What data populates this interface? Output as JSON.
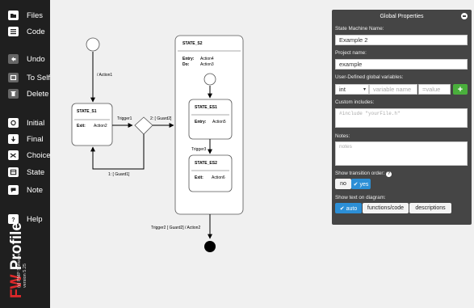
{
  "sidebar": {
    "items": [
      {
        "label": "Files",
        "icon": "folder-icon"
      },
      {
        "label": "Code",
        "icon": "list-icon"
      },
      {
        "label": "Undo",
        "icon": "undo-icon"
      },
      {
        "label": "To Self",
        "icon": "self-loop-icon"
      },
      {
        "label": "Delete",
        "icon": "trash-icon"
      },
      {
        "label": "Initial",
        "icon": "initial-state-icon"
      },
      {
        "label": "Final",
        "icon": "final-state-icon"
      },
      {
        "label": "Choice",
        "icon": "shuffle-icon"
      },
      {
        "label": "State",
        "icon": "state-icon"
      },
      {
        "label": "Note",
        "icon": "note-icon"
      },
      {
        "label": "Help",
        "icon": "help-icon"
      }
    ],
    "brand": {
      "fw": "FW",
      "profile": "Profile",
      "company": "(c) PMP Software",
      "version": "version 5.25"
    }
  },
  "diagram": {
    "s1": {
      "title": "STATE_S1",
      "exit_label": "Exit:",
      "exit_value": "Action2"
    },
    "s2": {
      "title": "STATE_S2",
      "entry_label": "Entry:",
      "entry_value": "Action4",
      "do_label": "Do:",
      "do_value": "Action3"
    },
    "es1": {
      "title": "STATE_ES1",
      "entry_label": "Entry:",
      "entry_value": "Action5"
    },
    "es2": {
      "title": "STATE_ES2",
      "exit_label": "Exit:",
      "exit_value": "Action6"
    },
    "labels": {
      "action1": "/ Action1",
      "trigger1": "Trigger1",
      "guard2": "2: [ Guard2]",
      "guard1": "1: [ Guard1]",
      "trigger3": "Trigger3",
      "trigger2": "Trigger2 [ Guard2] / Action2"
    }
  },
  "props": {
    "title": "Global Properties",
    "sm_name_label": "State Machine Name:",
    "sm_name_value": "Example 2",
    "project_label": "Project name:",
    "project_value": "example",
    "vars_label": "User-Defined global variables:",
    "var_type": "int",
    "var_name_placeholder": "variable name",
    "var_value_placeholder": "=value",
    "add_label": "+",
    "includes_label": "Custom includes:",
    "includes_placeholder": "#include \"yourFile.h\"",
    "notes_label": "Notes:",
    "notes_placeholder": "notes",
    "order_label": "Show transition order:",
    "order_no": "no",
    "order_yes": "✔ yes",
    "text_label": "Show text on diagram:",
    "text_auto": "✔ auto",
    "text_func": "functions/code",
    "text_desc": "descriptions",
    "colors": {
      "panel": "#454545",
      "accent": "#2c8fd6",
      "add": "#4aaf3c"
    }
  }
}
